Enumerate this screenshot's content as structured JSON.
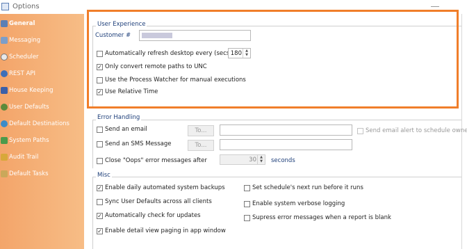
{
  "window": {
    "title": "Options"
  },
  "sidebar": {
    "items": [
      {
        "label": "General",
        "icon": "general-icon",
        "color": "#5b7fb5"
      },
      {
        "label": "Messaging",
        "icon": "messaging-icon",
        "color": "#7d9ec9"
      },
      {
        "label": "Scheduler",
        "icon": "scheduler-icon",
        "color": "#e8e8e8"
      },
      {
        "label": "REST API",
        "icon": "rest-api-icon",
        "color": "#3d6fb8"
      },
      {
        "label": "House Keeping",
        "icon": "house-keeping-icon",
        "color": "#3b5fa8"
      },
      {
        "label": "User Defaults",
        "icon": "user-defaults-icon",
        "color": "#5c8a3a"
      },
      {
        "label": "Default Destinations",
        "icon": "default-destinations-icon",
        "color": "#3c8cc8"
      },
      {
        "label": "System Paths",
        "icon": "system-paths-icon",
        "color": "#4b9a4b"
      },
      {
        "label": "Audit Trail",
        "icon": "audit-trail-icon",
        "color": "#d8a83a"
      },
      {
        "label": "Default Tasks",
        "icon": "default-tasks-icon",
        "color": "#caa85a"
      }
    ]
  },
  "user_experience": {
    "title": "User Experience",
    "customer_label": "Customer #",
    "auto_refresh_label": "Automatically refresh desktop every (secs)",
    "auto_refresh_checked": "",
    "refresh_secs": "180",
    "remote_paths_label": "Only convert remote paths to UNC",
    "remote_paths_checked": "✓",
    "process_watcher_label": "Use the Process Watcher for manual executions",
    "process_watcher_checked": "",
    "relative_time_label": "Use Relative Time",
    "relative_time_checked": "✓"
  },
  "error_handling": {
    "title": "Error Handling",
    "send_email_label": "Send an email",
    "send_email_checked": "",
    "to_label": "To...",
    "email_alert_label": "Send email alert to schedule owner",
    "email_alert_checked": "",
    "send_sms_label": "Send an SMS Message",
    "send_sms_checked": "",
    "sms_to_label": "To...",
    "oops_label": "Close \"Oops\" error messages after",
    "oops_checked": "",
    "oops_secs": "30",
    "seconds_label": "seconds"
  },
  "misc": {
    "title": "Misc",
    "daily_backup_label": "Enable daily automated system backups",
    "daily_backup_checked": "✓",
    "sync_defaults_label": "Sync User Defaults across all clients",
    "sync_defaults_checked": "",
    "check_updates_label": "Automatically check for updates",
    "check_updates_checked": "✓",
    "detail_paging_label": "Enable detail view paging in app window",
    "detail_paging_checked": "✓",
    "next_run_label": "Set schedule's next run before it runs",
    "next_run_checked": "",
    "verbose_logging_label": "Enable system verbose logging",
    "verbose_logging_checked": "",
    "suppress_errors_label": "Supress error messages when a report is blank",
    "suppress_errors_checked": ""
  },
  "colors": {
    "accent": "#f07e2a",
    "sidebar": "#f3a56a",
    "group_title": "#1e3f7a"
  }
}
